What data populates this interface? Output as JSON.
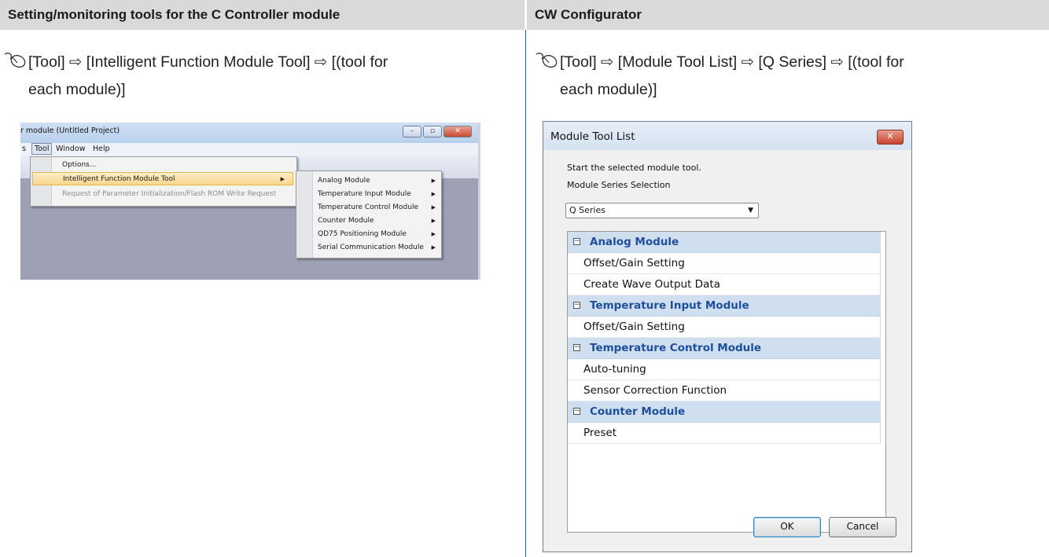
{
  "header": {
    "left_title": "Setting/monitoring tools for the C Controller module",
    "right_title": "CW Configurator"
  },
  "left": {
    "instruction_line1": "[Tool] ⇨ [Intelligent Function Module Tool] ⇨ [(tool for",
    "instruction_line2": "each module)]",
    "screenshot": {
      "window_title": "r module (Untitled Project)",
      "menubar": [
        "s",
        "Tool",
        "Window",
        "Help"
      ],
      "tool_menu": {
        "items": [
          "Options...",
          "Intelligent Function Module Tool",
          "Request of Parameter Initialization/Flash ROM Write Request"
        ]
      },
      "submenu": {
        "items": [
          "Analog Module",
          "Temperature Input Module",
          "Temperature Control Module",
          "Counter Module",
          "QD75 Positioning Module",
          "Serial Communication Module"
        ]
      },
      "window_buttons": {
        "minimize": "–",
        "maximize": "▫",
        "close": "✕"
      }
    }
  },
  "right": {
    "instruction_line1": "[Tool] ⇨ [Module Tool List] ⇨ [Q Series] ⇨ [(tool for",
    "instruction_line2": "each module)]",
    "dialog": {
      "title": "Module Tool List",
      "close": "✕",
      "hint": "Start the selected module tool.",
      "series_label": "Module Series Selection",
      "series_value": "Q Series",
      "groups": [
        {
          "name": "Analog Module",
          "items": [
            "Offset/Gain Setting",
            "Create Wave Output Data"
          ]
        },
        {
          "name": "Temperature Input Module",
          "items": [
            "Offset/Gain Setting"
          ]
        },
        {
          "name": "Temperature Control Module",
          "items": [
            "Auto-tuning",
            "Sensor Correction Function"
          ]
        },
        {
          "name": "Counter Module",
          "items": [
            "Preset"
          ]
        }
      ],
      "ok_label": "OK",
      "cancel_label": "Cancel"
    }
  },
  "icons": {
    "mouse": "mouse-icon",
    "toggle": "minus"
  }
}
